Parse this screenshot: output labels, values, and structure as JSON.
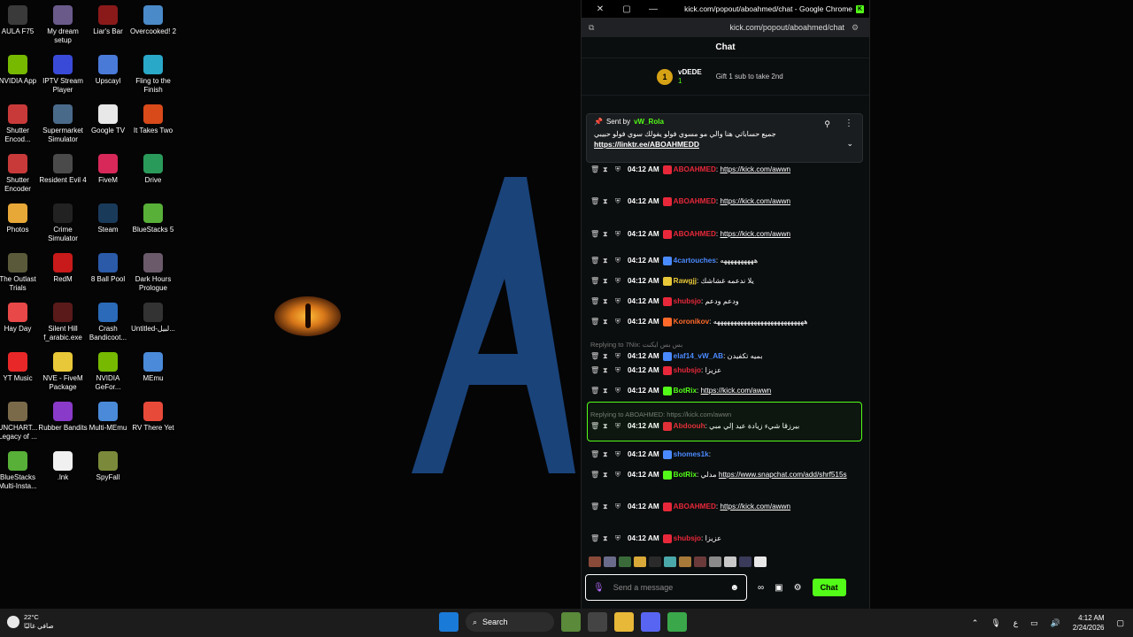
{
  "desktop": {
    "icons": [
      {
        "label": "AULA F75",
        "color": "#3a3a3a"
      },
      {
        "label": "My dream setup",
        "color": "#6a5a8a"
      },
      {
        "label": "Liar's Bar",
        "color": "#8a1a1a"
      },
      {
        "label": "Overcooked! 2",
        "color": "#4a8ac8"
      },
      {
        "label": "NVIDIA App",
        "color": "#76b900"
      },
      {
        "label": "IPTV Stream Player",
        "color": "#3a4ad8"
      },
      {
        "label": "Upscayl",
        "color": "#4a7ad8"
      },
      {
        "label": "Fling to the Finish",
        "color": "#2aa8c8"
      },
      {
        "label": "Shutter Encod...",
        "color": "#c83a3a"
      },
      {
        "label": "Supermarket Simulator",
        "color": "#4a6a8a"
      },
      {
        "label": "Google TV",
        "color": "#e8e8e8"
      },
      {
        "label": "It Takes Two",
        "color": "#d84a1a"
      },
      {
        "label": "Shutter Encoder",
        "color": "#c83a3a"
      },
      {
        "label": "Resident Evil 4",
        "color": "#4a4a4a"
      },
      {
        "label": "FiveM",
        "color": "#d8285a"
      },
      {
        "label": "Drive",
        "color": "#2a9a5a"
      },
      {
        "label": "Photos",
        "color": "#e8a838"
      },
      {
        "label": "Crime Simulator",
        "color": "#222222"
      },
      {
        "label": "Steam",
        "color": "#1a3a5a"
      },
      {
        "label": "BlueStacks 5",
        "color": "#58b038"
      },
      {
        "label": "The Outlast Trials",
        "color": "#5a5a3a"
      },
      {
        "label": "RedM",
        "color": "#c81a1a"
      },
      {
        "label": "8 Ball Pool",
        "color": "#2a5aa8"
      },
      {
        "label": "Dark Hours Prologue",
        "color": "#6a5a6a"
      },
      {
        "label": "Hay Day",
        "color": "#e84848"
      },
      {
        "label": "Silent Hill f_arabic.exe",
        "color": "#5a1a1a"
      },
      {
        "label": "Crash Bandicoot...",
        "color": "#2a6ab8"
      },
      {
        "label": "Untitled-لبيل...",
        "color": "#333333"
      },
      {
        "label": "YT Music",
        "color": "#e82828"
      },
      {
        "label": "NVE - FiveM Package",
        "color": "#e8c838"
      },
      {
        "label": "NVIDIA GeFor...",
        "color": "#76b900"
      },
      {
        "label": "MEmu",
        "color": "#4a8ad8"
      },
      {
        "label": "UNCHART... Legacy of ...",
        "color": "#7a6a4a"
      },
      {
        "label": "Rubber Bandits",
        "color": "#8a3ac8"
      },
      {
        "label": "Multi-MEmu",
        "color": "#4a8ad8"
      },
      {
        "label": "RV There Yet",
        "color": "#e84a3a"
      },
      {
        "label": "BlueStacks Multi-Insta...",
        "color": "#58b038"
      },
      {
        "label": ".lnk",
        "color": "#f0f0f0"
      },
      {
        "label": "SpyFall",
        "color": "#7a8a3a"
      }
    ]
  },
  "window": {
    "title": "kick.com/popout/aboahmed/chat - Google Chrome",
    "url": "kick.com/popout/aboahmed/chat",
    "header": "Chat"
  },
  "leaderboard": {
    "rank": "1",
    "user": "vDEDE",
    "count": "1",
    "gift_text": "Gift 1 sub to take 2nd"
  },
  "pinned": {
    "sent_by": "Sent by",
    "sender": "vW_Rola",
    "text": "جميع حساباتي هنا والي مو مسوي فولو يفولك سوي فولو حبيبي",
    "link": "https://linktr.ee/ABOAHMEDD"
  },
  "messages": [
    {
      "time": "04:12 AM",
      "user": "ABOAHMED",
      "user_color": "#e8283a",
      "text": "",
      "link": "https://kick.com/awwn"
    },
    {
      "time": "04:12 AM",
      "user": "ABOAHMED",
      "user_color": "#e8283a",
      "text": "",
      "link": "https://kick.com/awwn"
    },
    {
      "time": "04:12 AM",
      "user": "ABOAHMED",
      "user_color": "#e8283a",
      "text": "",
      "link": "https://kick.com/awwn"
    },
    {
      "time": "04:12 AM",
      "user": "4cartouches",
      "user_color": "#4a8aff",
      "text": "ههههههههههه",
      "link": ""
    },
    {
      "time": "04:12 AM",
      "user": "Rawgjj",
      "user_color": "#e8c838",
      "text": "يلا ندعمه غشاشك",
      "link": ""
    },
    {
      "time": "04:12 AM",
      "user": "shubsjo",
      "user_color": "#e8283a",
      "text": "ودعم ودعم",
      "link": ""
    },
    {
      "time": "04:12 AM",
      "user": "Koronikov",
      "user_color": "#ff6a2a",
      "text": "هههههههههههههههههههههههههههه",
      "link": ""
    },
    {
      "time": "04:12 AM",
      "user": "elaf14_vW_AB",
      "user_color": "#4a8aff",
      "text": "بميه تكفيدن",
      "link": "",
      "reply": "Replying to 7Nix: بس بس ايكنت"
    },
    {
      "time": "04:12 AM",
      "user": "shubsjo",
      "user_color": "#e8283a",
      "text": "عزيزا",
      "link": ""
    },
    {
      "time": "04:12 AM",
      "user": "BotRix",
      "user_color": "#53fc18",
      "text": "",
      "link": "https://kick.com/awwn"
    },
    {
      "time": "04:12 AM",
      "user": "Abdoouh",
      "user_color": "#e8283a",
      "text": "بيرزقا شيء زيادة عيد إلي مبي",
      "link": "",
      "reply": "Replying to ABOAHMED: https://kick.com/awwn"
    },
    {
      "time": "04:12 AM",
      "user": "shomes1k",
      "user_color": "#4a8aff",
      "text": "",
      "link": ""
    },
    {
      "time": "04:12 AM",
      "user": "BotRix",
      "user_color": "#53fc18",
      "text": "مدلي",
      "link": "https://www.snapchat.com/add/shrf515s"
    },
    {
      "time": "04:12 AM",
      "user": "ABOAHMED",
      "user_color": "#e8283a",
      "text": "",
      "link": "https://kick.com/awwn"
    },
    {
      "time": "04:12 AM",
      "user": "shubsjo",
      "user_color": "#e8283a",
      "text": "عزيزا",
      "link": ""
    }
  ],
  "input": {
    "placeholder": "Send a message",
    "send_label": "Chat"
  },
  "taskbar": {
    "temp": "22°C",
    "weather": "صافي غالبًا",
    "search": "Search",
    "lang": "ع",
    "time": "4:12 AM",
    "date": "2/24/2026"
  }
}
